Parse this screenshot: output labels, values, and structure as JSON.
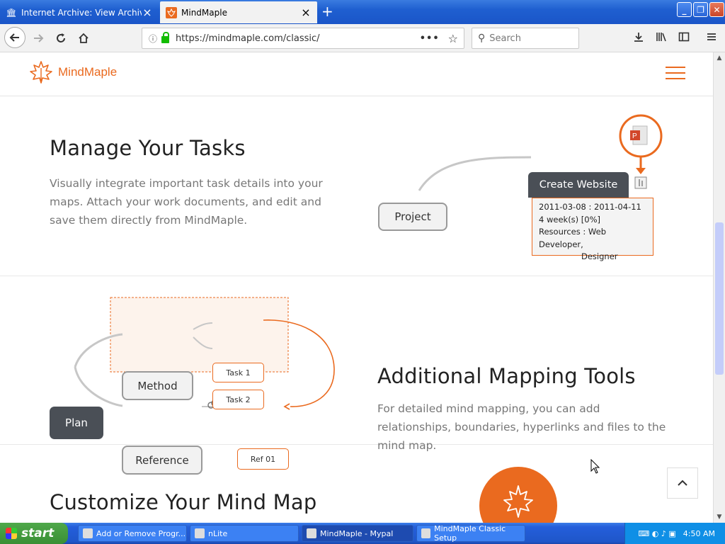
{
  "browser": {
    "tabs": [
      {
        "label": "Internet Archive: View Archive",
        "icon": "archive-icon",
        "active": false
      },
      {
        "label": "MindMaple",
        "icon": "mindmaple-favicon",
        "active": true
      }
    ],
    "url": "https://mindmaple.com/classic/",
    "search_placeholder": "Search"
  },
  "site": {
    "brand": "MindMaple",
    "accent_color": "#ea6a1f"
  },
  "sections": {
    "tasks": {
      "title": "Manage Your Tasks",
      "description_lines": [
        "Visually integrate important task details into your",
        "maps. Attach your work documents, and edit and",
        "save them directly from MindMaple."
      ],
      "diagram": {
        "root": "Project",
        "node": "Create Website",
        "info_lines": [
          "2011-03-08 : 2011-04-11",
          "4 week(s) [0%]",
          "Resources : Web Developer,",
          "Designer"
        ]
      }
    },
    "mapping": {
      "title": "Additional Mapping Tools",
      "description_lines": [
        "For detailed mind mapping, you can add",
        "relationships, boundaries, hyperlinks and files to the",
        "mind map."
      ],
      "diagram": {
        "root": "Plan",
        "method": "Method",
        "task1": "Task 1",
        "task2": "Task 2",
        "reference": "Reference",
        "ref01": "Ref 01"
      }
    },
    "customize": {
      "title": "Customize Your Mind Map"
    }
  },
  "taskbar": {
    "start_label": "start",
    "tasks": [
      "Add or Remove Progr...",
      "nLite",
      "MindMaple - Mypal",
      "MindMaple Classic Setup"
    ],
    "clock": "4:50 AM"
  }
}
